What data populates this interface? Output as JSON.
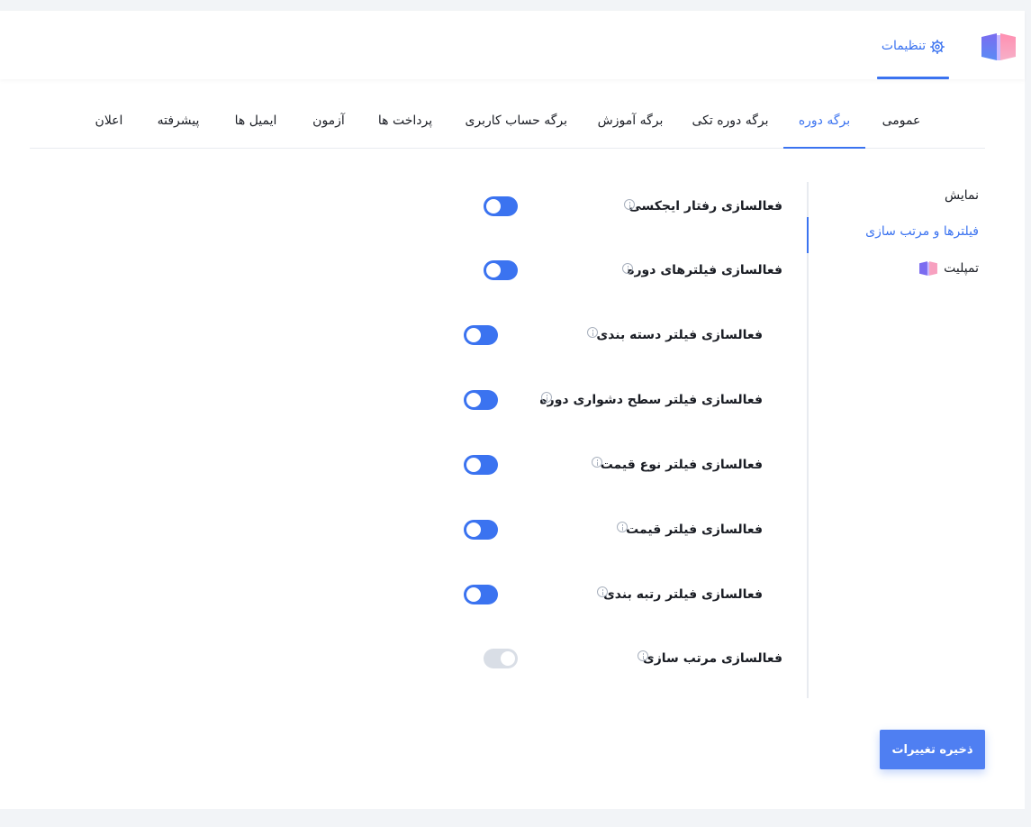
{
  "header": {
    "tab_label": "تنظیمات",
    "tab_icon": "gear-icon",
    "logo": "book-logo-icon"
  },
  "tabs": [
    {
      "label": "عمومی",
      "active": false
    },
    {
      "label": "برگه دوره",
      "active": true
    },
    {
      "label": "برگه دوره تکی",
      "active": false
    },
    {
      "label": "برگه آموزش",
      "active": false
    },
    {
      "label": "برگه حساب کاربری",
      "active": false
    },
    {
      "label": "پرداخت ها",
      "active": false
    },
    {
      "label": "آزمون",
      "active": false
    },
    {
      "label": "ایمیل ها",
      "active": false
    },
    {
      "label": "پیشرفته",
      "active": false
    },
    {
      "label": "اعلان",
      "active": false
    }
  ],
  "sidebar": {
    "items": [
      {
        "label": "نمایش",
        "active": false
      },
      {
        "label": "فیلترها و مرتب سازی",
        "active": true
      },
      {
        "label": "تمپلیت",
        "active": false,
        "icon": "book-logo-icon"
      }
    ]
  },
  "settings": [
    {
      "label": "فعالسازی رفتار ایجکسی",
      "enabled": true
    },
    {
      "label": "فعالسازی فیلترهای دوره",
      "enabled": true
    },
    {
      "label": "فعالسازی فیلتر دسته بندی",
      "enabled": true
    },
    {
      "label": "فعالسازی فیلتر سطح دشواری دوره",
      "enabled": true
    },
    {
      "label": "فعالسازی فیلتر نوع قیمت",
      "enabled": true
    },
    {
      "label": "فعالسازی فیلتر قیمت",
      "enabled": true
    },
    {
      "label": "فعالسازی فیلتر رتبه بندی",
      "enabled": true
    },
    {
      "label": "فعالسازی مرتب سازی",
      "enabled": false
    }
  ],
  "actions": {
    "save_label": "ذخیره تغییرات"
  },
  "colors": {
    "accent": "#3b73f0",
    "button": "#4f7ff2",
    "toggle_off": "#d9dee6"
  }
}
